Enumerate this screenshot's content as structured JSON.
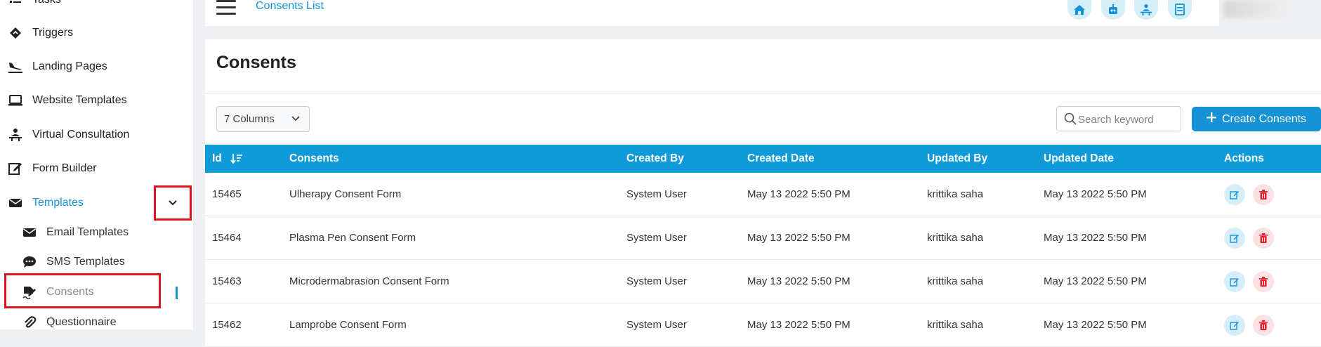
{
  "sidebar": {
    "items": [
      {
        "label": "Tasks",
        "icon": "tasks-icon"
      },
      {
        "label": "Triggers",
        "icon": "trigger-icon"
      },
      {
        "label": "Landing Pages",
        "icon": "plane-landing-icon"
      },
      {
        "label": "Website Templates",
        "icon": "laptop-icon"
      },
      {
        "label": "Virtual Consultation",
        "icon": "consultation-icon"
      },
      {
        "label": "Form Builder",
        "icon": "edit-form-icon"
      },
      {
        "label": "Templates",
        "icon": "envelope-icon"
      },
      {
        "label": "Email Templates",
        "icon": "envelope-icon"
      },
      {
        "label": "SMS Templates",
        "icon": "chat-icon"
      },
      {
        "label": "Consents",
        "icon": "signature-icon"
      },
      {
        "label": "Questionnaire",
        "icon": "paperclip-icon"
      }
    ]
  },
  "topbar": {
    "breadcrumb": "Consents List",
    "icons": [
      "home-icon",
      "robot-icon",
      "consultation-icon",
      "document-icon"
    ]
  },
  "page": {
    "title": "Consents",
    "columns_select": "7 Columns",
    "search_placeholder": "Search keyword",
    "create_button": "Create Consents"
  },
  "table": {
    "headers": [
      "Id",
      "Consents",
      "Created By",
      "Created Date",
      "Updated By",
      "Updated Date",
      "Actions"
    ],
    "rows": [
      {
        "id": "15465",
        "name": "Ulherapy Consent Form",
        "created_by": "System User",
        "created_date": "May 13 2022 5:50 PM",
        "updated_by": "krittika saha",
        "updated_date": "May 13 2022 5:50 PM"
      },
      {
        "id": "15464",
        "name": "Plasma Pen Consent Form",
        "created_by": "System User",
        "created_date": "May 13 2022 5:50 PM",
        "updated_by": "krittika saha",
        "updated_date": "May 13 2022 5:50 PM"
      },
      {
        "id": "15463",
        "name": "Microdermabrasion Consent Form",
        "created_by": "System User",
        "created_date": "May 13 2022 5:50 PM",
        "updated_by": "krittika saha",
        "updated_date": "May 13 2022 5:50 PM"
      },
      {
        "id": "15462",
        "name": "Lamprobe Consent Form",
        "created_by": "System User",
        "created_date": "May 13 2022 5:50 PM",
        "updated_by": "krittika saha",
        "updated_date": "May 13 2022 5:50 PM"
      }
    ]
  },
  "colors": {
    "accent": "#1592d6",
    "header": "#0f9ad9",
    "highlight": "#e0141e"
  }
}
